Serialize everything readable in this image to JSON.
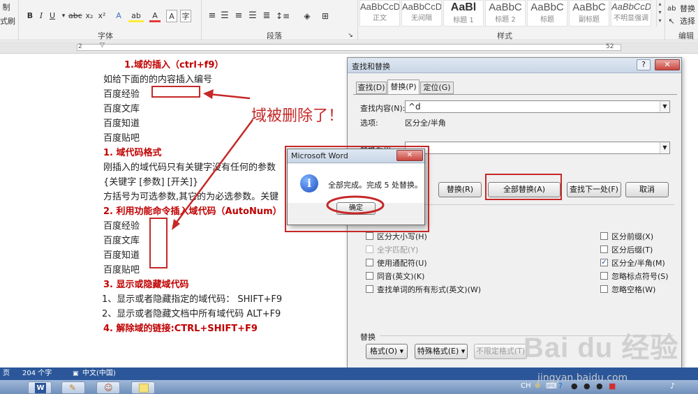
{
  "ribbon": {
    "left_labels": [
      "制",
      "式刷"
    ],
    "font_group": "字体",
    "paragraph_group": "段落",
    "styles_group": "样式",
    "editing_group": "编辑",
    "styles": [
      {
        "sample": "AaBbCcDd",
        "name": "正文"
      },
      {
        "sample": "AaBbCcDd",
        "name": "无间隔"
      },
      {
        "sample": "AaBl",
        "name": "标题 1"
      },
      {
        "sample": "AaBbC",
        "name": "标题 2"
      },
      {
        "sample": "AaBbC",
        "name": "标题"
      },
      {
        "sample": "AaBbC",
        "name": "副标题"
      },
      {
        "sample": "AaBbCcDd",
        "name": "不明显强调"
      }
    ],
    "replace_label": "替换",
    "select_label": "选择"
  },
  "ruler": {
    "left_number": "2",
    "right_number": "52"
  },
  "document": {
    "lines": [
      {
        "text": "1.域的插入（ctrl+f9）",
        "style": "red"
      },
      {
        "text": "如给下面的的内容插入编号",
        "style": "normal"
      },
      {
        "text": "百度经验",
        "style": "normal"
      },
      {
        "text": "百度文库",
        "style": "normal"
      },
      {
        "text": "百度知道",
        "style": "normal"
      },
      {
        "text": "百度贴吧",
        "style": "normal"
      },
      {
        "text": "1.    域代码格式",
        "style": "red"
      },
      {
        "text": "刚插入的域代码只有关键字没有任何的参数",
        "style": "normal"
      },
      {
        "text": "{关键字  [参数] [开关]}",
        "style": "normal"
      },
      {
        "text": "方括号为可选参数,其它的为必选参数。关键",
        "style": "normal"
      },
      {
        "text": "2.    利用功能命令插入域代码（AutoNum）",
        "style": "red"
      },
      {
        "text": "百度经验",
        "style": "normal"
      },
      {
        "text": "百度文库",
        "style": "normal"
      },
      {
        "text": "百度知道",
        "style": "normal"
      },
      {
        "text": "百度贴吧",
        "style": "normal"
      },
      {
        "text": "3.    显示或隐藏域代码",
        "style": "red"
      },
      {
        "text": "1、显示或者隐藏指定的域代码：   SHIFT+F9",
        "style": "normal"
      },
      {
        "text": "2、显示或者隐藏文档中所有域代码 ALT+F9",
        "style": "normal"
      },
      {
        "text": "4.    解除域的链接:CTRL+SHIFT+F9",
        "style": "red"
      }
    ],
    "annotation": "域被删除了！"
  },
  "find_replace": {
    "title": "查找和替换",
    "help": "?",
    "close": "✕",
    "tabs": [
      "查找(D)",
      "替换(P)",
      "定位(G)"
    ],
    "find_label": "查找内容(N):",
    "find_value": "^d",
    "options_label": "选项:",
    "options_value": "区分全/半角",
    "replace_label": "替换为(I):",
    "replace_value": "",
    "buttons": {
      "replace": "替换(R)",
      "replace_all": "全部替换(A)",
      "find_next": "查找下一处(F)",
      "cancel": "取消"
    },
    "left_options": [
      {
        "label": "区分大小写(H)",
        "checked": false,
        "enabled": true
      },
      {
        "label": "全字匹配(Y)",
        "checked": false,
        "enabled": false
      },
      {
        "label": "使用通配符(U)",
        "checked": false,
        "enabled": true
      },
      {
        "label": "同音(英文)(K)",
        "checked": false,
        "enabled": true
      },
      {
        "label": "查找单词的所有形式(英文)(W)",
        "checked": false,
        "enabled": true
      }
    ],
    "right_options": [
      {
        "label": "区分前缀(X)",
        "checked": false
      },
      {
        "label": "区分后缀(T)",
        "checked": false
      },
      {
        "label": "区分全/半角(M)",
        "checked": true
      },
      {
        "label": "忽略标点符号(S)",
        "checked": false
      },
      {
        "label": "忽略空格(W)",
        "checked": false
      }
    ],
    "replace_section": "替换",
    "format_button": "格式(O) ▾",
    "special_button": "特殊格式(E) ▾",
    "no_format_button": "不限定格式(T)"
  },
  "message_box": {
    "title": "Microsoft Word",
    "close": "✕",
    "message": "全部完成。完成 5 处替换。",
    "ok": "确定"
  },
  "status_bar": {
    "page": "页",
    "words": "204 个字",
    "language": "中文(中国)"
  },
  "tray": {
    "ime": "CH"
  },
  "watermark": {
    "logo": "Bai du 经验",
    "url": "jingyan.baidu.com"
  },
  "colors": {
    "accent_red": "#c62828",
    "dialog_bg": "#f0f0f0",
    "status_blue": "#2b579a"
  }
}
